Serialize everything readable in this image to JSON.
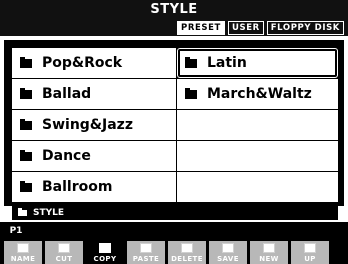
{
  "header": {
    "title": "STYLE",
    "tabs": [
      {
        "label": "PRESET",
        "active": true
      },
      {
        "label": "USER",
        "active": false
      },
      {
        "label": "FLOPPY DISK",
        "active": false
      }
    ]
  },
  "folders": {
    "left": [
      "Pop&Rock",
      "Ballad",
      "Swing&Jazz",
      "Dance",
      "Ballroom"
    ],
    "right": [
      "Latin",
      "March&Waltz"
    ]
  },
  "path": {
    "label": "STYLE"
  },
  "page": {
    "label": "P1"
  },
  "toolbar": [
    {
      "label": "NAME",
      "icon": "name-icon"
    },
    {
      "label": "CUT",
      "icon": "cut-icon"
    },
    {
      "label": "COPY",
      "icon": "copy-icon"
    },
    {
      "label": "PASTE",
      "icon": "paste-icon"
    },
    {
      "label": "DELETE",
      "icon": "delete-icon"
    },
    {
      "label": "SAVE",
      "icon": "save-icon"
    },
    {
      "label": "NEW",
      "icon": "new-folder-icon"
    },
    {
      "label": "UP",
      "icon": "up-icon"
    }
  ]
}
